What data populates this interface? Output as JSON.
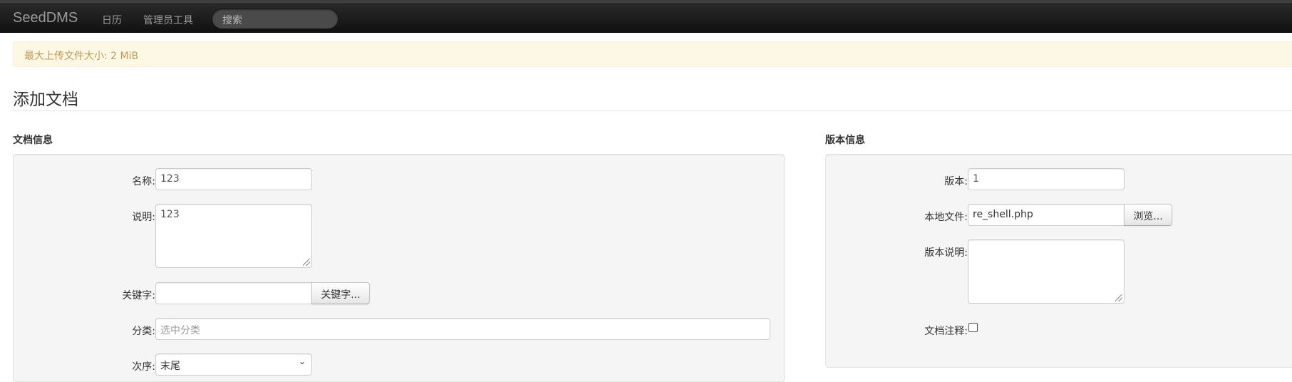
{
  "navbar": {
    "brand": "SeedDMS",
    "links": [
      "日历",
      "管理员工具"
    ],
    "search_placeholder": "搜索"
  },
  "alert": {
    "text": "最大上传文件大小: 2 MiB"
  },
  "page": {
    "title": "添加文档"
  },
  "doc_info": {
    "heading": "文档信息",
    "name_label": "名称:",
    "name_value": "123",
    "description_label": "说明:",
    "description_value": "123",
    "keywords_label": "关键字:",
    "keywords_value": "",
    "keywords_button": "关键字...",
    "category_label": "分类:",
    "category_placeholder": "选中分类",
    "order_label": "次序:",
    "order_value": "末尾"
  },
  "version_info": {
    "heading": "版本信息",
    "version_label": "版本:",
    "version_value": "1",
    "local_file_label": "本地文件:",
    "local_file_value": "re_shell.php",
    "browse_button": "浏览...",
    "version_comment_label": "版本说明:",
    "version_comment_value": "",
    "doc_comment_label": "文档注释:",
    "doc_comment_checked": false
  },
  "colors": {
    "navbar_bg": "#1b1b1b",
    "alert_bg": "#fcf8e3",
    "alert_text": "#c09853",
    "well_bg": "#f5f5f5"
  }
}
